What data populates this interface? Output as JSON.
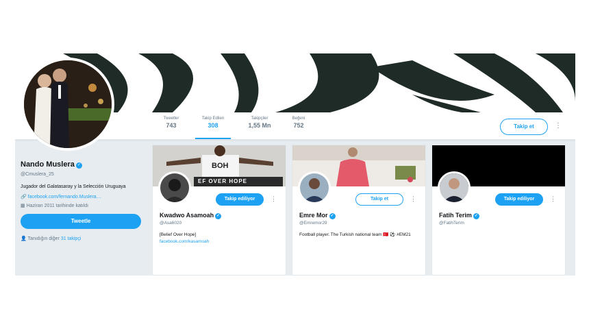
{
  "profile": {
    "name": "Nando Muslera",
    "handle": "@Cmuslera_25",
    "bio": "Jugador del Galatasaray y la Selección Uruguaya",
    "website": "facebook.com/fernando.Muslera…",
    "joined": "Haziran 2011 tarihinde katıldı",
    "tweet_button": "Tweetle",
    "known_followers_prefix": "Tanıdığın diğer",
    "known_followers_link": "31 takipçi",
    "follow_button": "Takip et"
  },
  "stats": [
    {
      "label": "Tweetler",
      "value": "743"
    },
    {
      "label": "Takip Edilen",
      "value": "308"
    },
    {
      "label": "Takipçiler",
      "value": "1,55 Mn"
    },
    {
      "label": "Beğeni",
      "value": "752"
    }
  ],
  "cards": [
    {
      "name": "Kwadwo Asamoah",
      "handle": "@Asa6020",
      "follow_label": "Takip ediliyor",
      "bio": "[Belief Over Hope]",
      "bio_link": "facebook.com/kasamoah",
      "banner_text": "BOH",
      "banner_subtext": "EF OVER HOPE"
    },
    {
      "name": "Emre Mor",
      "handle": "@Emremor29",
      "follow_label": "Takip et",
      "bio": "Football player. The Turkish national team 🇹🇷 ⚽ #EM21"
    },
    {
      "name": "Fatih Terim",
      "handle": "@FatihTerim",
      "follow_label": "Takip ediliyor"
    }
  ],
  "colors": {
    "accent": "#1da1f2",
    "banner_pattern": "#1f2b27"
  }
}
